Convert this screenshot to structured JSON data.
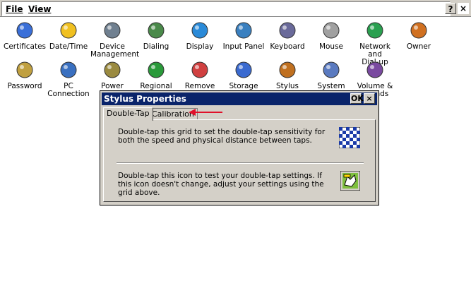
{
  "menu": {
    "file_label": "File",
    "view_label": "View",
    "help_label": "?",
    "close_label": "×"
  },
  "control_panel": {
    "items": [
      {
        "label": "Certificates",
        "icon": "certificates-icon"
      },
      {
        "label": "Date/Time",
        "icon": "date-time-icon"
      },
      {
        "label": "Device\nManagement",
        "icon": "device-management-icon"
      },
      {
        "label": "Dialing",
        "icon": "dialing-icon"
      },
      {
        "label": "Display",
        "icon": "display-icon"
      },
      {
        "label": "Input Panel",
        "icon": "input-panel-icon"
      },
      {
        "label": "Keyboard",
        "icon": "keyboard-icon"
      },
      {
        "label": "Mouse",
        "icon": "mouse-icon"
      },
      {
        "label": "Network and\nDial-up Co...",
        "icon": "network-icon"
      },
      {
        "label": "Owner",
        "icon": "owner-icon"
      },
      {
        "label": "Password",
        "icon": "password-icon"
      },
      {
        "label": "PC\nConnection",
        "icon": "pc-connection-icon"
      },
      {
        "label": "Power",
        "icon": "power-icon"
      },
      {
        "label": "Regional",
        "icon": "regional-icon"
      },
      {
        "label": "Remove",
        "icon": "remove-programs-icon"
      },
      {
        "label": "Storage",
        "icon": "storage-icon"
      },
      {
        "label": "Stylus",
        "icon": "stylus-icon"
      },
      {
        "label": "System",
        "icon": "system-icon"
      },
      {
        "label": "Volume &\nSounds",
        "icon": "volume-icon"
      }
    ]
  },
  "dialog": {
    "title": "Stylus Properties",
    "ok_label": "OK",
    "close_label": "×",
    "tabs": [
      {
        "label": "Double-Tap",
        "active": true
      },
      {
        "label": "Calibration",
        "active": false
      }
    ],
    "grid_text": "Double-tap this grid to set the double-tap sensitivity for both the speed and physical distance between taps.",
    "test_text": "Double-tap this icon to test your double-tap settings. If this icon doesn't change, adjust your settings using the grid above.",
    "grid_icon": "checkerboard-grid-icon",
    "test_icon": "test-hand-icon"
  },
  "annotation": {
    "arrow_color": "#e0102a"
  }
}
